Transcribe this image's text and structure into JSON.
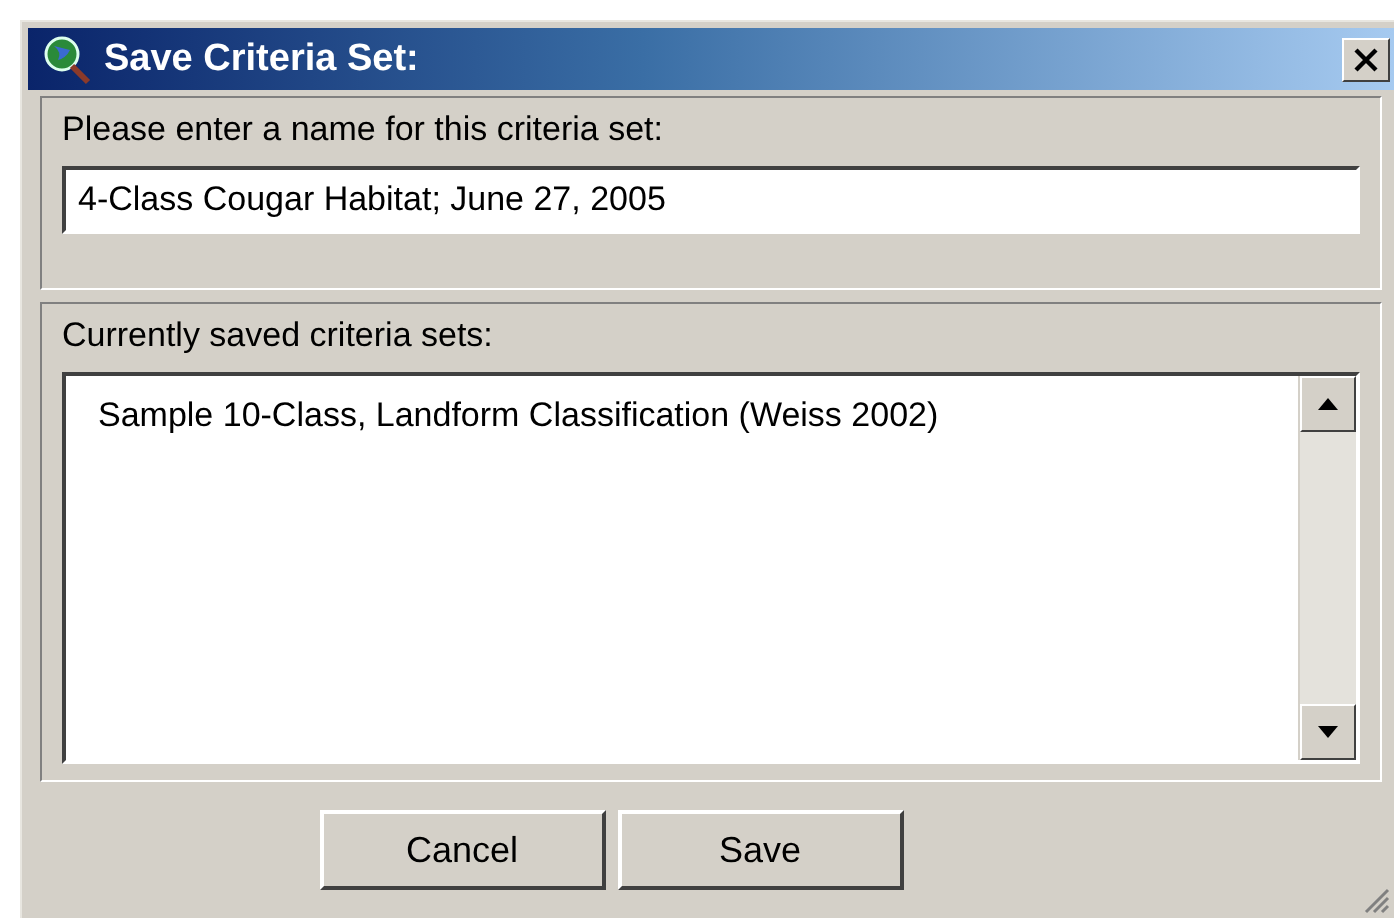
{
  "window": {
    "title": "Save Criteria Set:"
  },
  "name_section": {
    "label": "Please enter a name for this criteria set:",
    "value": "4-Class Cougar Habitat; June 27, 2005"
  },
  "saved_section": {
    "label": "Currently saved criteria sets:",
    "items": [
      "Sample 10-Class, Landform Classification (Weiss 2002)"
    ]
  },
  "buttons": [
    "Cancel",
    "Save"
  ]
}
